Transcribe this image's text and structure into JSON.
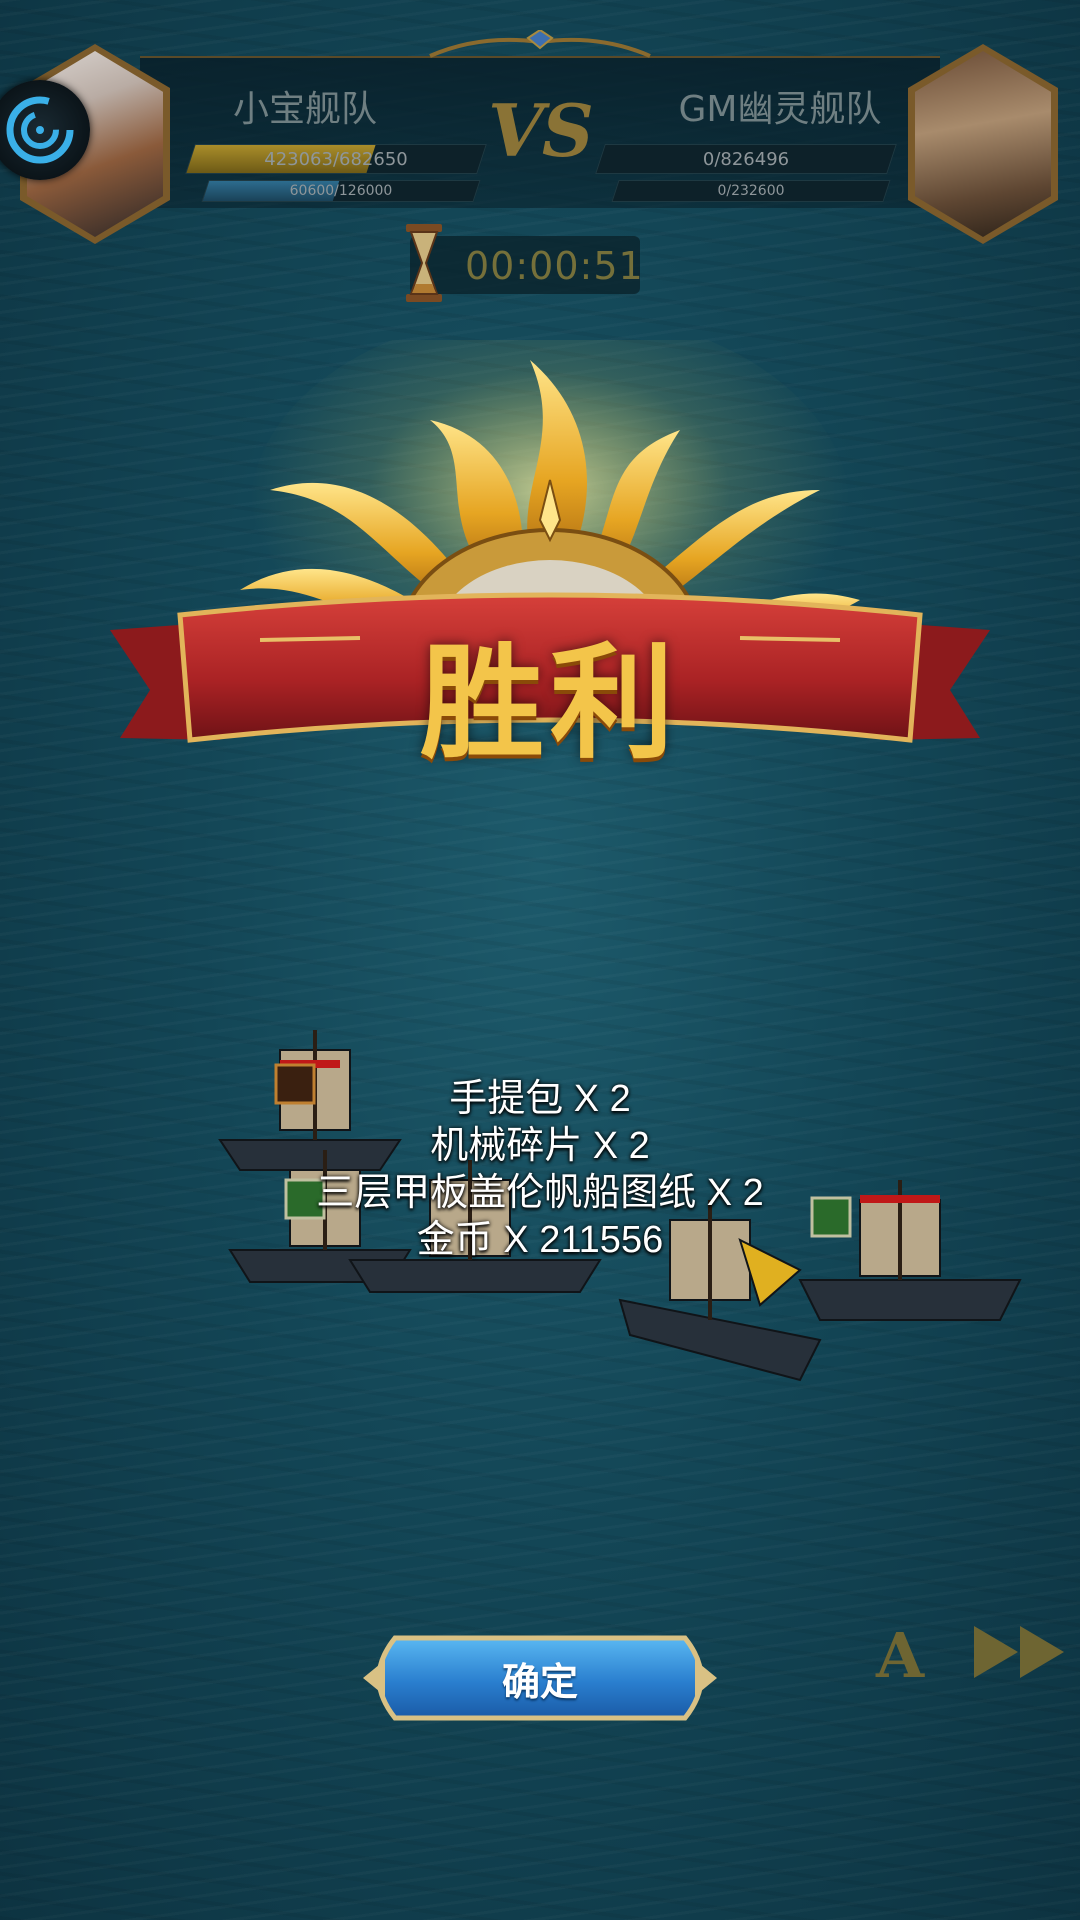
{
  "hud": {
    "left_team": {
      "name": "小宝舰队",
      "hp": "423063/682650",
      "hp_fraction": 0.62,
      "sp": "60600/126000",
      "sp_fraction": 0.48
    },
    "vs": "VS",
    "right_team": {
      "name": "GM幽灵舰队",
      "hp": "0/826496",
      "hp_fraction": 0,
      "sp": "0/232600",
      "sp_fraction": 0
    },
    "timer": "00:00:51"
  },
  "result": {
    "title": "胜利"
  },
  "rewards": [
    "手提包 X 2",
    "机械碎片 X 2",
    "三层甲板盖伦帆船图纸 X 2",
    "金币 X 211556"
  ],
  "controls": {
    "confirm_label": "确定",
    "auto_label": "A"
  },
  "colors": {
    "sea": "#134656",
    "gold": "#f3c54a",
    "ribbon_red": "#b5282a",
    "button_blue": "#2a7fcf"
  }
}
